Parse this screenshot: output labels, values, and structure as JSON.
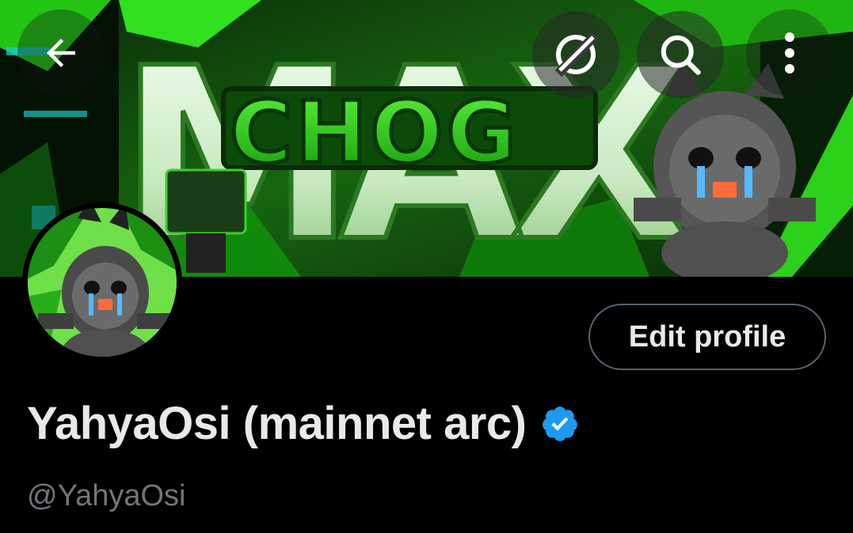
{
  "header": {
    "icons": {
      "back": "arrow-left-icon",
      "grok": "grok-icon",
      "search": "search-icon",
      "more": "more-vertical-icon"
    }
  },
  "banner": {
    "text_big": "MAX",
    "text_logo": "CHOG",
    "colors": {
      "primary": "#22c414",
      "dark": "#0b3d0a",
      "light": "#b9f5a6"
    }
  },
  "profile": {
    "edit_button_label": "Edit profile",
    "display_name": "YahyaOsi (mainnet arc)",
    "handle": "@YahyaOsi",
    "verified": true,
    "verified_color": "#1d9bf0"
  },
  "theme": {
    "background": "#000000",
    "text_primary": "#e7e9ea",
    "text_secondary": "#71767b",
    "border": "#536471"
  }
}
